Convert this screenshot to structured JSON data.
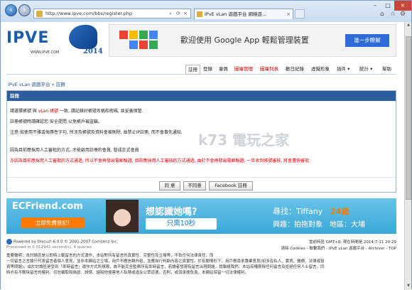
{
  "browser": {
    "url": "http://www.ipve.com/bbs/register.php",
    "tab_title": "IPvE vLan 遊戲平台 網絡遊...",
    "back_icon": "back-arrow-icon",
    "forward_icon": "forward-arrow-icon"
  },
  "header": {
    "logo_text": "IPVE",
    "logo_url": "WWW.IPVE.COM",
    "logo_year": "2014",
    "google_banner": {
      "text": "歡迎使用 Google App 輕鬆管理裝置",
      "button": "進一步瞭解"
    }
  },
  "menu": {
    "items": [
      "註冊",
      "登錄",
      "會員",
      "圖庫管理",
      "圖庫列表",
      "歡日紀錄",
      "虛擬形象",
      "插件 ▾",
      "統計 ▾",
      "幫助"
    ]
  },
  "breadcrumb": "IPvE vLan 遊戲平台 » 註冊",
  "register": {
    "header": "註冊",
    "line1a": "請選擇帳號 與 ",
    "line1b": "vLan 帳號",
    "line1c": " 一致, 請記錄好帳號名稱和密碼, 並妥善保管.",
    "line2": "註冊帳號時請確認您 安全提問 以免帳戶被盜竊。",
    "line3": "注意:如使用不雅或侮辱性字句, 所涉及帳號及資料會被刪除, 並禁止IP註冊, 而不會事先通知.",
    "line4": "因為目前應採用人工審批的方式, 才能啟用註冊的會員, 暫成正式會員",
    "line5": "亦因為目前應採用人工審批的方式通過, 所以不會再發出電郵驗證, 目前應採用人工審核的方式通過, 由於不會再發出電郵驗證, 一旦收到帳號審核, 將會盡快審批.",
    "buttons": [
      "同 意",
      "不同意",
      "Facebook 註冊"
    ]
  },
  "ad": {
    "logo": "ECFriend.com",
    "free_button": "立即免費登記!",
    "question": "想認識她嗎?",
    "time": "只需10秒",
    "find": "尋找：Tiffany",
    "age": "24歲",
    "tags": "興趣：拍拖對象　地區：大埔"
  },
  "footer": {
    "powered": "Powered by Discuz! 6.0.0 © 2001-2007 Comsenz Inc.",
    "processed": "Processed in 0.012941 second(s), 4 queries.",
    "timezone": "當前時區 GMT+8, 現在時間是 2014-7-11 20:29",
    "links": "清除 Cookies - 聯繫我們 - IPvE vLan 遊戲平台 - Archiver - TOP",
    "disclaimer": [
      "重要聲明：本討論區是以即時上載留言的方式運作，本站對所有留言的真實性、完整性及立場等，不負任何法律責任，而",
      "一切留言之言論只代表留言者個人意見，並非本網站之立場，用戶不應信賴內容，並應自行判斷內容之真實性。於有關情形下，用戶應尋求專業意見(如涉及私人、實貨、醫療、法律或投",
      "資等問題)。由於討論區是受到「即時留言」運作方式所規限，故不能完全監察所有即時留言，若讀者發現有留言出現問題，請聯絡我們。本站有權刪除任何留言及拒絕任何人士留言，同",
      "時亦有不刪除留言的權利。切勿攝取和偽冒、誹謗、誣陷他侵害他人私隱或違反公眾道德，否則，或須承擔負責。本網站保留一切法律權利。"
    ]
  },
  "watermark": "k73 電玩之家"
}
